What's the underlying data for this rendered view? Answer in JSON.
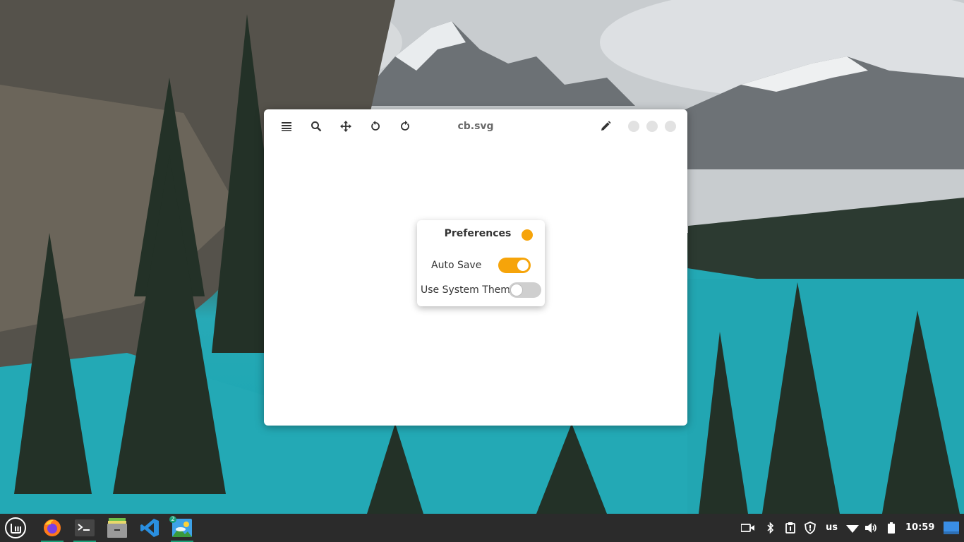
{
  "window": {
    "title": "cb.svg"
  },
  "headerbar": {
    "icons": [
      "menu-icon",
      "search-icon",
      "move-icon",
      "rotate-left-icon",
      "rotate-right-icon",
      "pencil-icon"
    ]
  },
  "preferences": {
    "title": "Preferences",
    "auto_save_label": "Auto Save",
    "auto_save_on": true,
    "system_theme_label": "Use System Theme",
    "system_theme_on": false,
    "accent": "#f6a40a"
  },
  "taskbar": {
    "apps": [
      "linux-mint-menu-icon",
      "firefox-icon",
      "terminal-icon",
      "files-icon",
      "vscode-icon",
      "image-viewer-icon"
    ],
    "image_viewer_badge": "2",
    "keyboard_layout": "us",
    "clock": "10:59",
    "accent": "#1aa17a"
  }
}
